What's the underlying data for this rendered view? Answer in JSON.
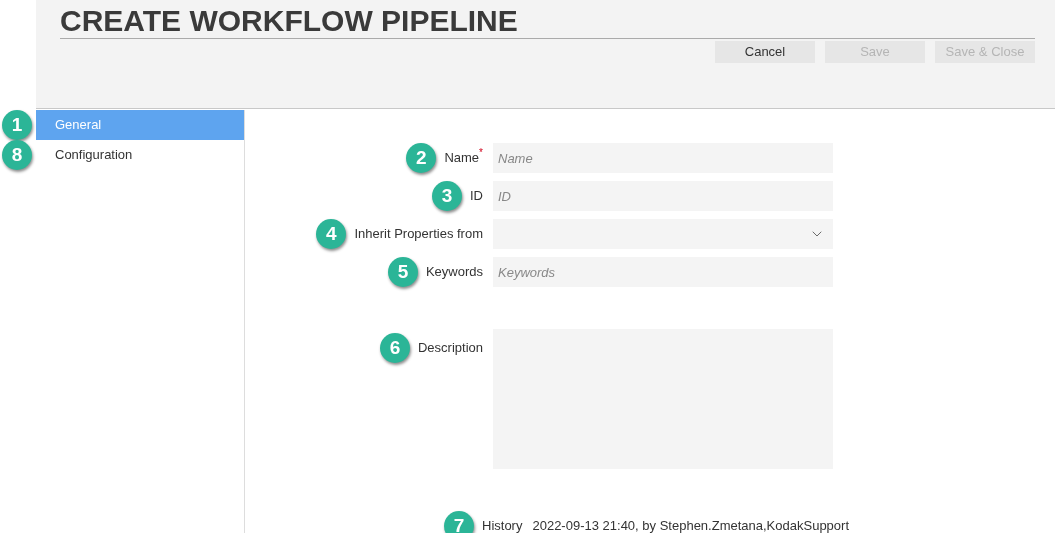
{
  "title": "CREATE WORKFLOW PIPELINE",
  "buttons": [
    {
      "label": "Cancel",
      "disabled": false
    },
    {
      "label": "Save",
      "disabled": true
    },
    {
      "label": "Save & Close",
      "disabled": true
    }
  ],
  "sidebar": {
    "items": [
      {
        "label": "General",
        "selected": true,
        "callout": "1"
      },
      {
        "label": "Configuration",
        "selected": false,
        "callout": "8"
      }
    ]
  },
  "fields": [
    {
      "kind": "text",
      "label": "Name",
      "required_mark": "*",
      "placeholder": "Name",
      "callout": "2"
    },
    {
      "kind": "text",
      "label": "ID",
      "placeholder": "ID",
      "callout": "3"
    },
    {
      "kind": "select",
      "label": "Inherit Properties from",
      "callout": "4"
    },
    {
      "kind": "text",
      "label": "Keywords",
      "placeholder": "Keywords",
      "callout": "5"
    },
    {
      "kind": "textarea",
      "label": "Description",
      "callout": "6"
    }
  ],
  "history": {
    "label": "History",
    "value": "2022-09-13 21:40, by Stephen.Zmetana,KodakSupport",
    "callout": "7"
  }
}
